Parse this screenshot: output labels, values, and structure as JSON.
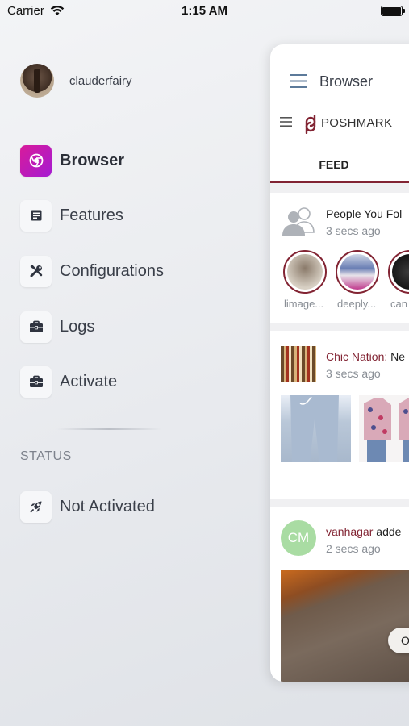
{
  "status_bar": {
    "carrier": "Carrier",
    "time": "1:15 AM"
  },
  "profile": {
    "username": "clauderfairy"
  },
  "menu": {
    "items": [
      {
        "label": "Browser",
        "icon": "browser-icon",
        "active": true
      },
      {
        "label": "Features",
        "icon": "document-icon",
        "active": false
      },
      {
        "label": "Configurations",
        "icon": "tools-icon",
        "active": false
      },
      {
        "label": "Logs",
        "icon": "briefcase-icon",
        "active": false
      },
      {
        "label": "Activate",
        "icon": "briefcase-icon",
        "active": false
      }
    ]
  },
  "status": {
    "heading": "STATUS",
    "value": "Not Activated",
    "icon": "rocket-icon"
  },
  "app": {
    "title": "Browser",
    "brand": "POSHMARK",
    "tab": "FEED",
    "feed": [
      {
        "title": "People You Fol",
        "time": "3 secs ago",
        "users": [
          "limage...",
          "deeply...",
          "can"
        ]
      },
      {
        "title_brand": "Chic Nation:",
        "title_rest": " Ne",
        "time": "3 secs ago"
      },
      {
        "initials": "CM",
        "title_brand": "vanhagar",
        "title_rest": " adde",
        "time": "2 secs ago",
        "button": "O"
      }
    ]
  },
  "colors": {
    "accent_magenta": "#d81b9a",
    "poshmark_maroon": "#822433",
    "avatar_green": "#a9dca3"
  }
}
